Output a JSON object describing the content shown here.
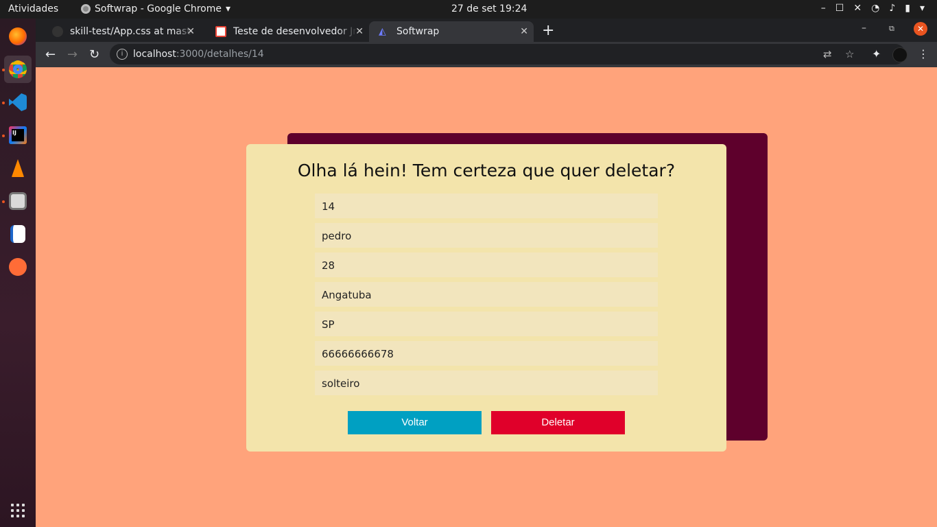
{
  "topbar": {
    "activities": "Atividades",
    "app_title": "Softwrap - Google Chrome",
    "clock": "27 de set  19:24"
  },
  "browser": {
    "tabs": [
      {
        "label": "skill-test/App.css at master",
        "icon": "github-icon"
      },
      {
        "label": "Teste de desenvolvedor Jr",
        "icon": "gmail-icon"
      },
      {
        "label": "Softwrap",
        "icon": "softwrap-icon",
        "active": true
      }
    ],
    "url_host": "localhost",
    "url_path": ":3000/detalhes/14"
  },
  "dock": {
    "items": [
      "firefox-icon",
      "chrome-icon",
      "vscode-icon",
      "intellij-icon",
      "vlc-icon",
      "files-icon",
      "writer-icon",
      "postman-icon"
    ]
  },
  "page": {
    "title": "Olha lá hein! Tem certeza que quer deletar?",
    "fields": [
      "14",
      "pedro",
      "28",
      "Angatuba",
      "SP",
      "66666666678",
      "solteiro"
    ],
    "back_button": "Voltar",
    "delete_button": "Deletar"
  },
  "colors": {
    "background": "#ffa37b",
    "card": "#f3e4ab",
    "card_shadow": "#5e002c",
    "voltar": "#00a0c2",
    "deletar": "#e0002a"
  }
}
